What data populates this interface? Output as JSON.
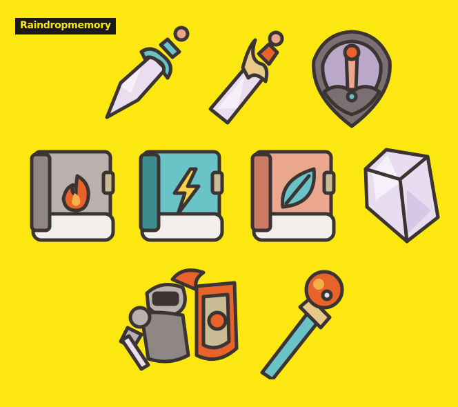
{
  "brand": {
    "label": "Raindropmemory"
  },
  "icons": [
    {
      "name": "steel-sword",
      "kind": "sword"
    },
    {
      "name": "gilded-sword",
      "kind": "sword"
    },
    {
      "name": "crest-shield",
      "kind": "shield"
    },
    {
      "name": "fire-spellbook",
      "kind": "book",
      "element": "fire"
    },
    {
      "name": "lightning-spellbook",
      "kind": "book",
      "element": "lightning"
    },
    {
      "name": "nature-spellbook",
      "kind": "book",
      "element": "leaf"
    },
    {
      "name": "crystal-gem",
      "kind": "gem"
    },
    {
      "name": "knight-hero",
      "kind": "character"
    },
    {
      "name": "orb-scepter",
      "kind": "staff"
    }
  ],
  "colors": {
    "background": "#FCE710",
    "outline": "#3B3433",
    "blade": "#EADDEF",
    "teal": "#6AC3C7",
    "orange": "#E7632A",
    "stone": "#B8B1AE",
    "peach": "#EBA78E",
    "gem": "#E8DDF0"
  }
}
